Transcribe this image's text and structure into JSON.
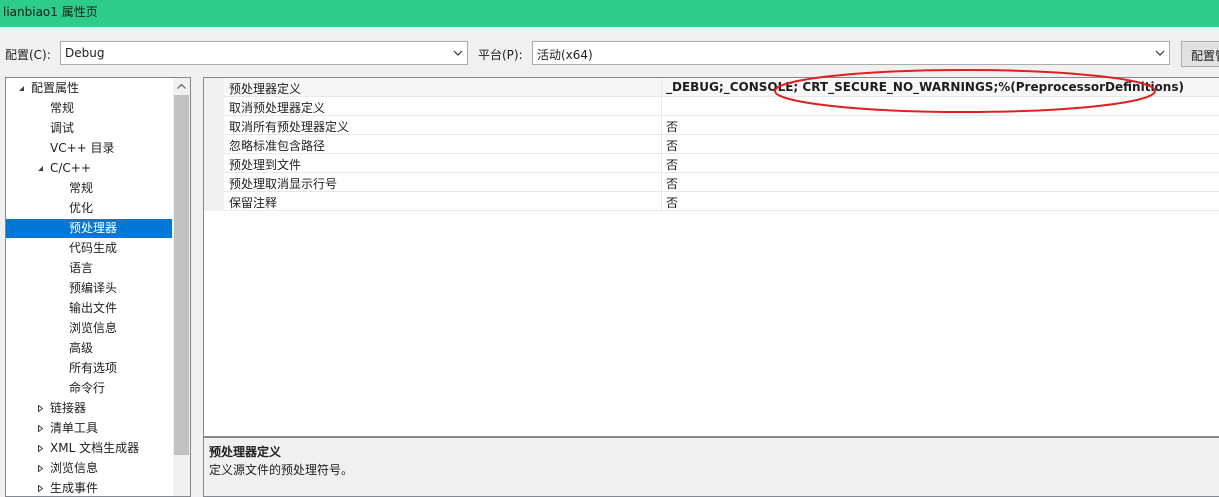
{
  "window": {
    "title": "lianbiao1 属性页"
  },
  "config": {
    "config_label": "配置(C):",
    "config_value": "Debug",
    "platform_label": "平台(P):",
    "platform_value": "活动(x64)",
    "manager_button": "配置管理器"
  },
  "tree": {
    "items": [
      {
        "label": "配置属性",
        "expander": "expanded"
      },
      {
        "label": "常规"
      },
      {
        "label": "调试"
      },
      {
        "label": "VC++ 目录"
      },
      {
        "label": "C/C++",
        "expander": "expanded"
      },
      {
        "label": "常规"
      },
      {
        "label": "优化"
      },
      {
        "label": "预处理器",
        "selected": true
      },
      {
        "label": "代码生成"
      },
      {
        "label": "语言"
      },
      {
        "label": "预编译头"
      },
      {
        "label": "输出文件"
      },
      {
        "label": "浏览信息"
      },
      {
        "label": "高级"
      },
      {
        "label": "所有选项"
      },
      {
        "label": "命令行"
      },
      {
        "label": "链接器",
        "expander": "collapsed"
      },
      {
        "label": "清单工具",
        "expander": "collapsed"
      },
      {
        "label": "XML 文档生成器",
        "expander": "collapsed"
      },
      {
        "label": "浏览信息",
        "expander": "collapsed"
      },
      {
        "label": "生成事件",
        "expander": "collapsed"
      }
    ]
  },
  "properties": [
    {
      "name": "预处理器定义",
      "value": "_DEBUG;_CONSOLE; CRT_SECURE_NO_WARNINGS;%(PreprocessorDefinitions)",
      "bold": true
    },
    {
      "name": "取消预处理器定义",
      "value": ""
    },
    {
      "name": "取消所有预处理器定义",
      "value": "否"
    },
    {
      "name": "忽略标准包含路径",
      "value": "否"
    },
    {
      "name": "预处理到文件",
      "value": "否"
    },
    {
      "name": "预处理取消显示行号",
      "value": "否"
    },
    {
      "name": "保留注释",
      "value": "否"
    }
  ],
  "description": {
    "title": "预处理器定义",
    "text": "定义源文件的预处理符号。"
  },
  "colors": {
    "titlebar": "#2ecc8b",
    "selection": "#0078d7",
    "annotation": "#e02020"
  }
}
